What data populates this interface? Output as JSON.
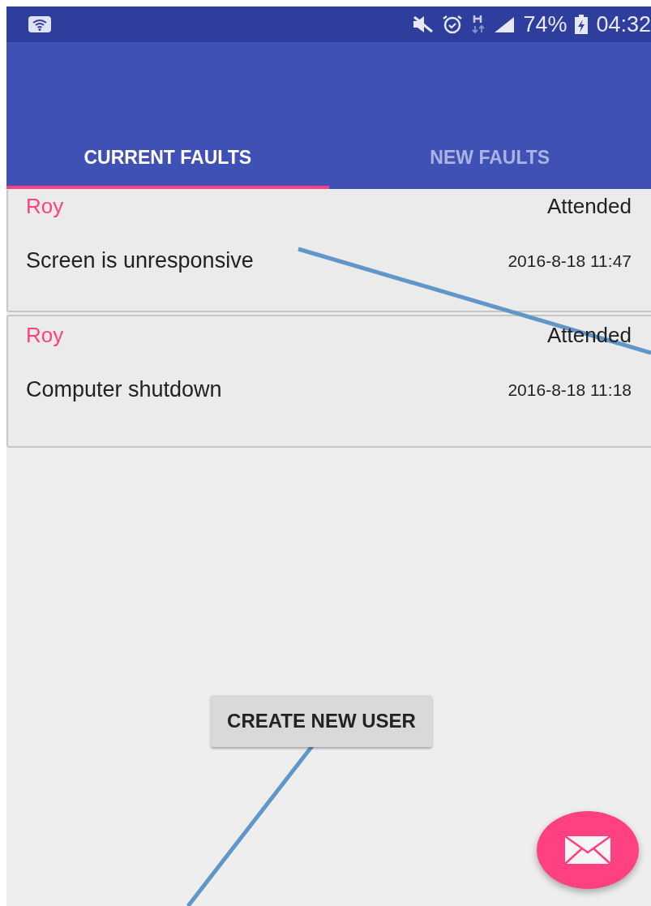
{
  "status_bar": {
    "battery": "74%",
    "time": "04:32"
  },
  "tabs": [
    {
      "label": "CURRENT FAULTS",
      "selected": true
    },
    {
      "label": "NEW FAULTS",
      "selected": false
    }
  ],
  "faults": [
    {
      "name": "Roy",
      "status": "Attended",
      "description": "Screen is unresponsive",
      "time": "2016-8-18 11:47"
    },
    {
      "name": "Roy",
      "status": "Attended",
      "description": "Computer shutdown",
      "time": "2016-8-18 11:18"
    }
  ],
  "create_button": "CREATE NEW USER"
}
